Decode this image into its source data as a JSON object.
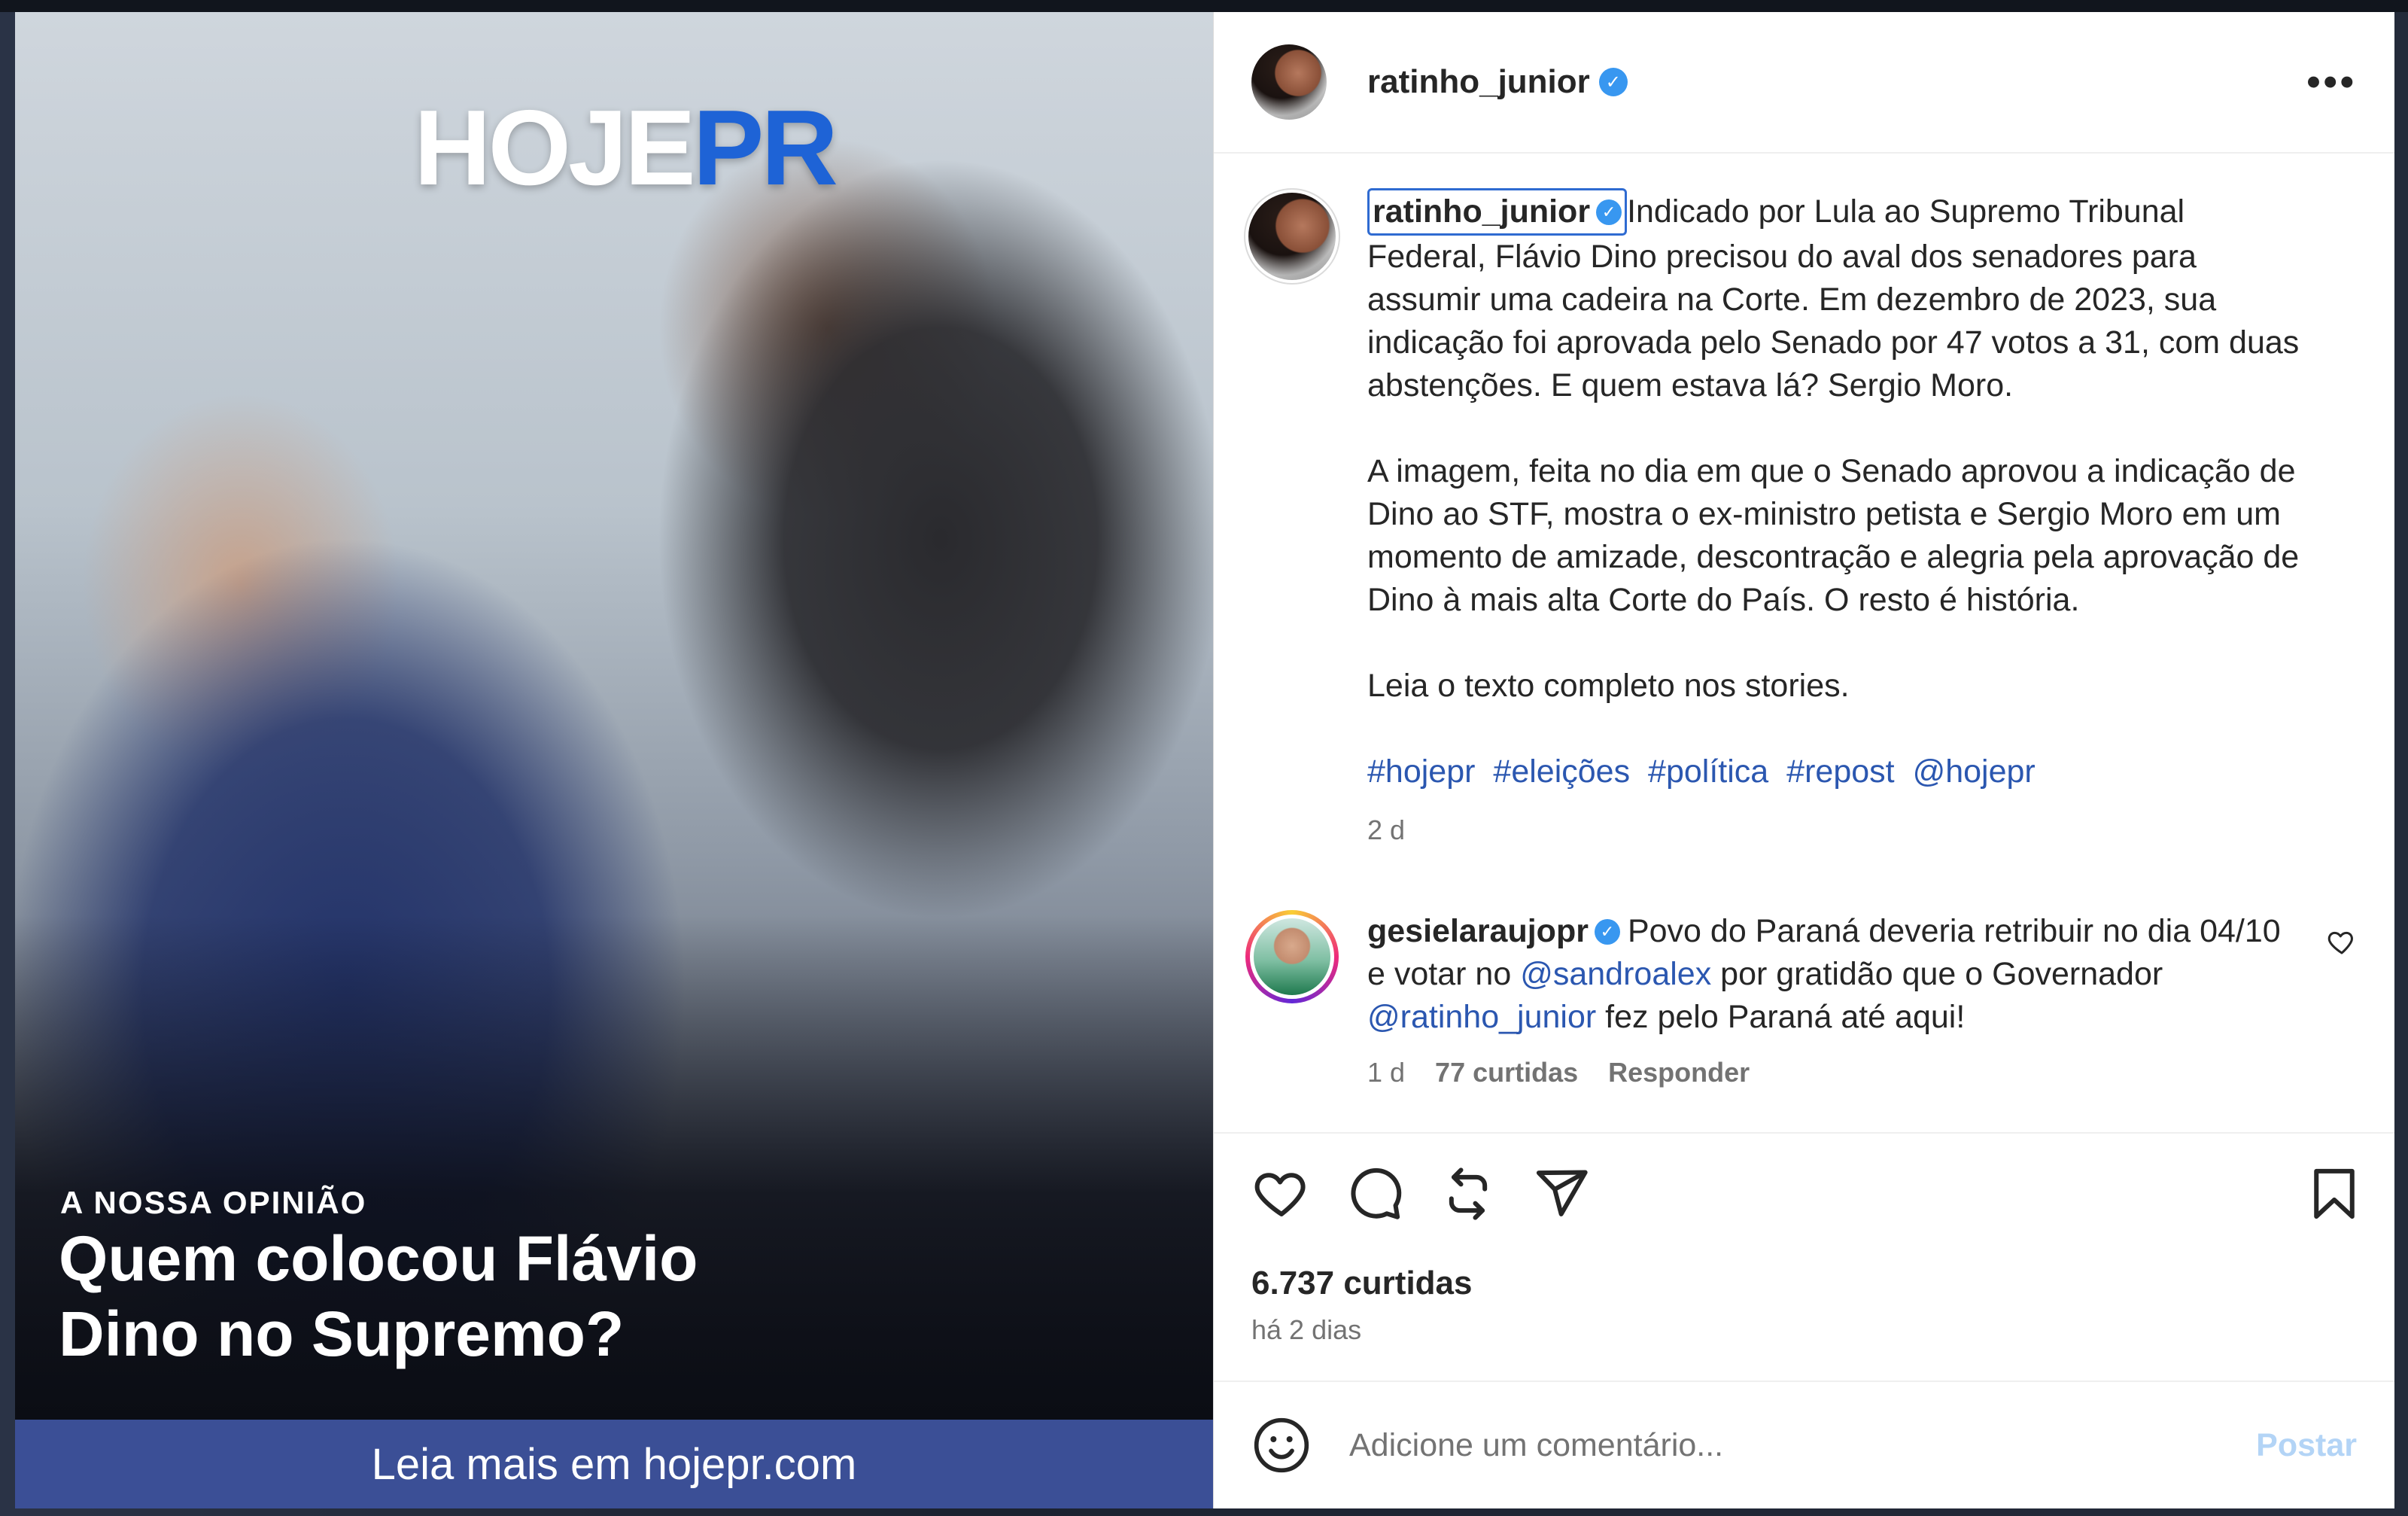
{
  "media": {
    "brand_part1": "HOJE",
    "brand_part2": "PR",
    "kicker": "A NOSSA OPINIÃO",
    "headline_line1": "Quem colocou Flávio",
    "headline_line2": "Dino no Supremo?",
    "cta": "Leia mais em hojepr.com",
    "brand_blue": "#1e63d6",
    "cta_bar_color": "#3b4f96"
  },
  "header": {
    "username": "ratinho_junior",
    "verified": true,
    "more_icon": "more-horizontal-icon"
  },
  "caption": {
    "username": "ratinho_junior",
    "paragraph1": "Indicado por Lula ao Supremo Tribunal Federal, Flávio Dino precisou do aval dos senadores para assumir uma cadeira na Corte. Em dezembro de 2023, sua indicação foi aprovada pelo Senado por 47 votos a 31, com duas abstenções. E quem estava lá? Sergio Moro.",
    "paragraph2": "A imagem, feita no dia em que o Senado aprovou a indicação de Dino ao STF, mostra o ex-ministro petista e Sergio Moro em um momento de amizade, descontração e alegria pela aprovação de Dino à mais alta Corte do País. O resto é história.",
    "paragraph3": "Leia o texto completo nos stories.",
    "hashtags": [
      "#hojepr",
      "#eleições",
      "#política",
      "#repost",
      "@hojepr"
    ],
    "time": "2 d"
  },
  "comment": {
    "username": "gesielaraujopr",
    "text_before": "Povo do Paraná deveria retribuir no dia 04/10 e votar no ",
    "mention1": "@sandroalex",
    "text_middle": " por gratidão que o Governador ",
    "mention2": "@ratinho_junior",
    "text_after": " fez pelo Paraná até aqui!",
    "time": "1 d",
    "likes": "77 curtidas",
    "reply": "Responder"
  },
  "actions": {
    "likes": "6.737 curtidas",
    "ago": "há 2 dias",
    "icons": [
      "heart-icon",
      "comment-icon",
      "repost-icon",
      "share-icon",
      "bookmark-icon"
    ]
  },
  "add_comment": {
    "placeholder": "Adicione um comentário...",
    "post_label": "Postar"
  },
  "colors": {
    "link": "#2b57b0",
    "verified": "#3897f0",
    "post_disabled": "#b3d4f6"
  }
}
